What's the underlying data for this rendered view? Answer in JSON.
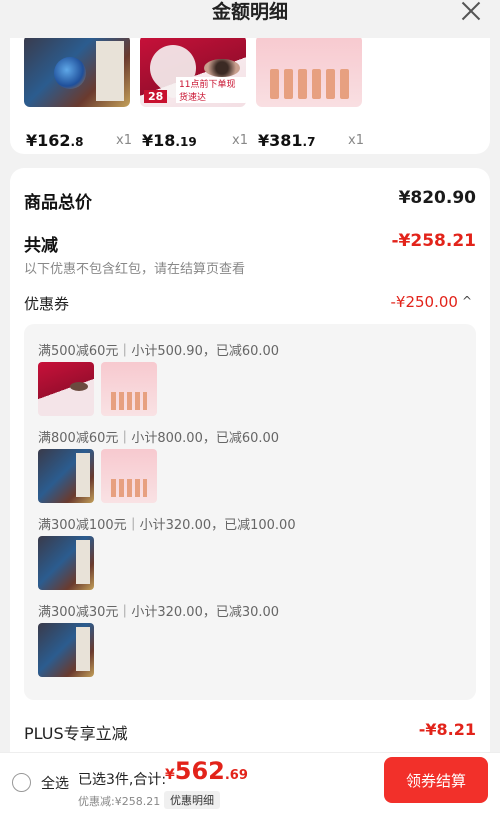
{
  "header": {
    "title": "金额明细"
  },
  "products": [
    {
      "price_int": "¥162",
      "price_dec": ".8",
      "qty": "x1"
    },
    {
      "price_int": "¥18",
      "price_dec": ".19",
      "qty": "x1",
      "badge": "28",
      "badge_text": "11点前下单现货速达"
    },
    {
      "price_int": "¥381",
      "price_dec": ".7",
      "qty": "x1"
    }
  ],
  "summary": {
    "goods_total_label": "商品总价",
    "goods_total_value": "¥820.90",
    "discount_label": "共减",
    "discount_value": "-¥258.21",
    "discount_note": "以下优惠不包含红包，请在结算页查看",
    "coupon_label": "优惠券",
    "coupon_value": "-¥250.00",
    "plus_label": "PLUS专享立减",
    "plus_value": "-¥8.21"
  },
  "coupons": [
    {
      "rule": "满500减60元｜小计500.90，已减60.00",
      "thumbs": [
        "lip",
        "ess"
      ]
    },
    {
      "rule": "满800减60元｜小计800.00，已减60.00",
      "thumbs": [
        "book",
        "ess"
      ]
    },
    {
      "rule": "满300减100元｜小计320.00，已减100.00",
      "thumbs": [
        "book"
      ]
    },
    {
      "rule": "满300减30元｜小计320.00，已减30.00",
      "thumbs": [
        "book"
      ]
    }
  ],
  "footer": {
    "select_all": "全选",
    "selected_text": "已选3件,合计:",
    "total_cur": "¥",
    "total_int": "562",
    "total_dec": ".69",
    "discount_text": "优惠减:¥258.21",
    "detail_link": "优惠明细",
    "checkout": "领券结算"
  },
  "colors": {
    "accent": "#e2231a",
    "button": "#f2302a"
  }
}
